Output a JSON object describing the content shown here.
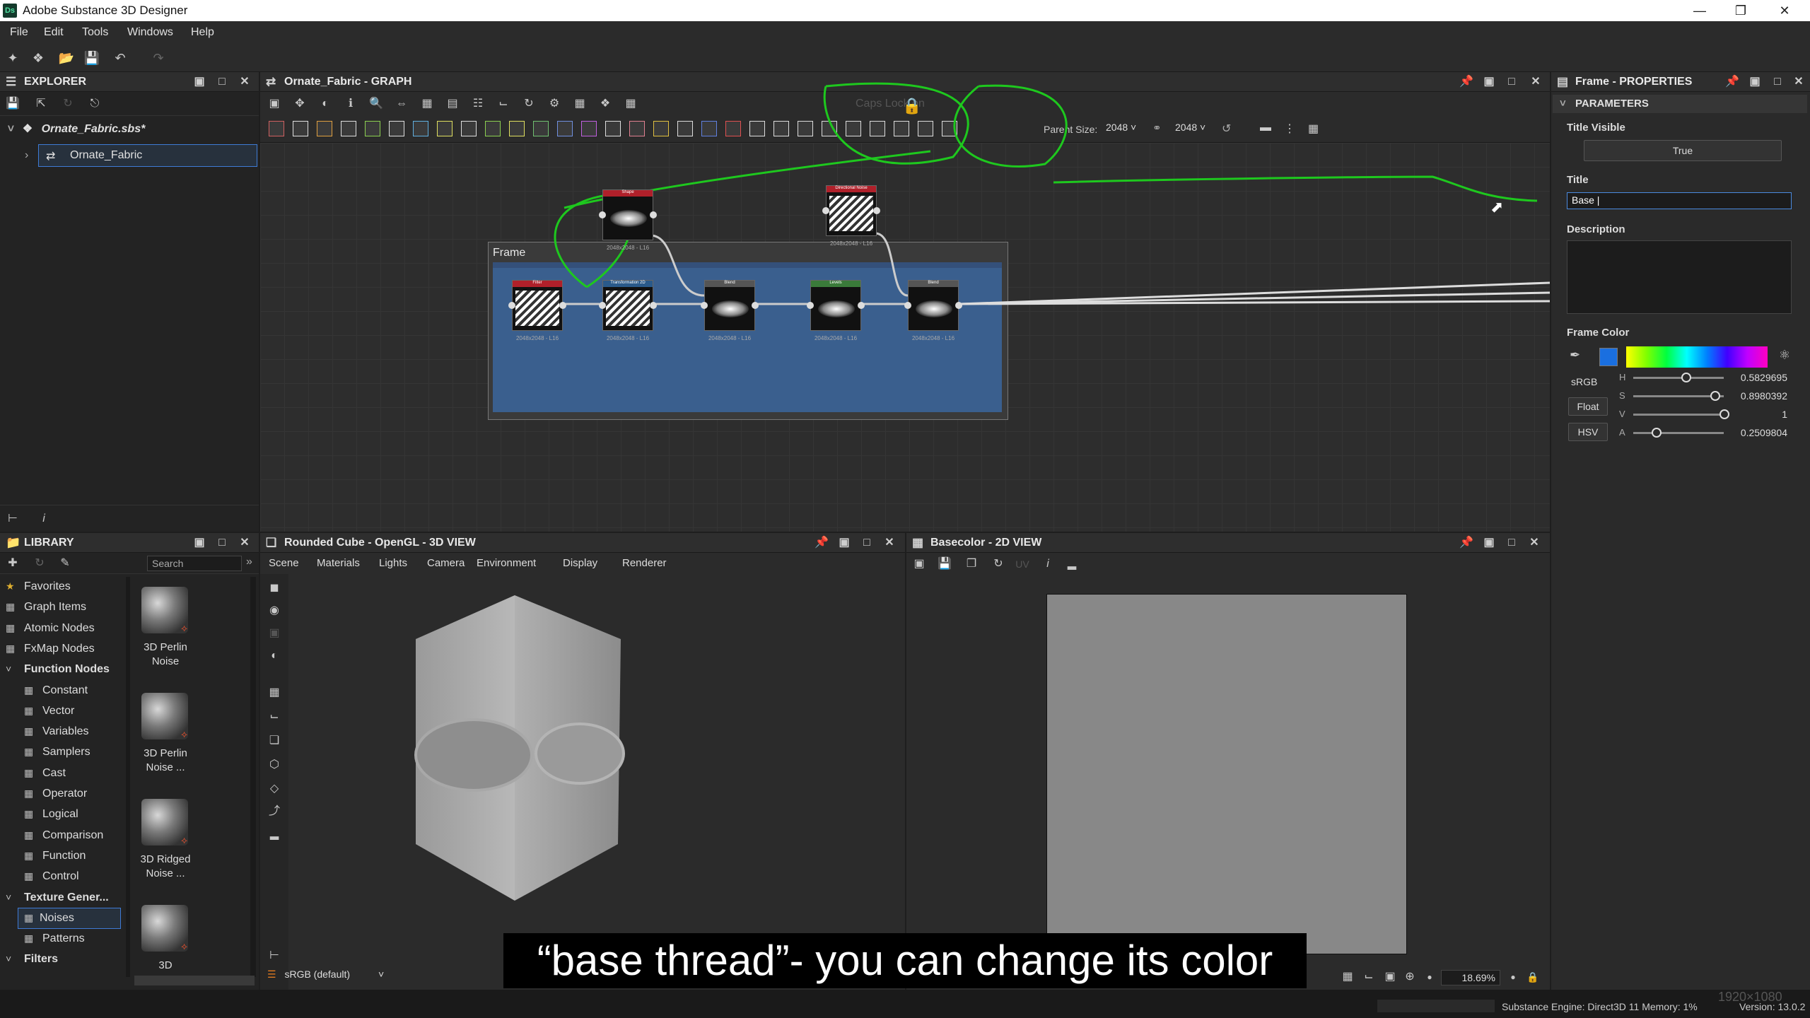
{
  "app": {
    "title": "Adobe Substance 3D Designer",
    "logo": "Ds"
  },
  "menu": [
    "File",
    "Edit",
    "Tools",
    "Windows",
    "Help"
  ],
  "explorer": {
    "title": "EXPLORER",
    "package": "Ornate_Fabric.sbs*",
    "graph_item": "Ornate_Fabric"
  },
  "graph": {
    "title": "Ornate_Fabric - GRAPH",
    "parent_size_label": "Parent Size:",
    "parent_size": "2048",
    "size2": "2048",
    "caps_lock": "Caps Lock on",
    "frame_title": "Frame",
    "nodes": [
      {
        "label": "Shape",
        "res": "2048x2048 - L16",
        "color": "#b0202a"
      },
      {
        "label": "Directional Noise",
        "res": "2048x2048 - L16",
        "color": "#b0202a"
      },
      {
        "label": "Filter",
        "res": "2048x2048 - L16",
        "color": "#b0202a"
      },
      {
        "label": "Transformation 2D",
        "res": "2048x2048 - L16",
        "color": "#2a5a8a"
      },
      {
        "label": "Blend",
        "res": "2048x2048 - L16",
        "color": "#555555"
      },
      {
        "label": "Levels",
        "res": "2048x2048 - L16",
        "color": "#3a7a3a"
      },
      {
        "label": "Blend",
        "res": "2048x2048 - L16",
        "color": "#555555"
      }
    ]
  },
  "properties": {
    "title": "Frame - PROPERTIES",
    "section": "PARAMETERS",
    "title_visible_label": "Title Visible",
    "title_visible_value": "True",
    "title_label": "Title",
    "title_value": "Base |",
    "description_label": "Description",
    "frame_color_label": "Frame Color",
    "color_space": "sRGB",
    "float_btn": "Float",
    "hsv_btn": "HSV",
    "channels": [
      {
        "name": "H",
        "value": "0.5829695",
        "level": 0.58
      },
      {
        "name": "S",
        "value": "0.8980392",
        "level": 0.9
      },
      {
        "name": "V",
        "value": "1",
        "level": 1.0
      },
      {
        "name": "A",
        "value": "0.2509804",
        "level": 0.25
      }
    ],
    "swatch_color": "#1a6fe0"
  },
  "library": {
    "title": "LIBRARY",
    "search_placeholder": "Search",
    "items": [
      {
        "label": "Favorites",
        "icon": "star-icon",
        "indent": 0
      },
      {
        "label": "Graph Items",
        "icon": "graph-items-icon",
        "indent": 0
      },
      {
        "label": "Atomic Nodes",
        "icon": "atomic-icon",
        "indent": 0
      },
      {
        "label": "FxMap Nodes",
        "icon": "fxmap-icon",
        "indent": 0
      },
      {
        "label": "Function Nodes",
        "icon": "chevron-down-icon",
        "indent": 0,
        "cat": true
      },
      {
        "label": "Constant",
        "icon": "function-icon",
        "indent": 1
      },
      {
        "label": "Vector",
        "icon": "function-icon",
        "indent": 1
      },
      {
        "label": "Variables",
        "icon": "function-icon",
        "indent": 1
      },
      {
        "label": "Samplers",
        "icon": "function-icon",
        "indent": 1
      },
      {
        "label": "Cast",
        "icon": "function-icon",
        "indent": 1
      },
      {
        "label": "Operator",
        "icon": "function-icon",
        "indent": 1
      },
      {
        "label": "Logical",
        "icon": "function-icon",
        "indent": 1
      },
      {
        "label": "Comparison",
        "icon": "function-icon",
        "indent": 1
      },
      {
        "label": "Function",
        "icon": "function-icon",
        "indent": 1
      },
      {
        "label": "Control",
        "icon": "function-icon",
        "indent": 1
      },
      {
        "label": "Texture Gener...",
        "icon": "chevron-down-icon",
        "indent": 0,
        "cat": true
      },
      {
        "label": "Noises",
        "icon": "noise-icon",
        "indent": 1,
        "selected": true
      },
      {
        "label": "Patterns",
        "icon": "pattern-icon",
        "indent": 1
      },
      {
        "label": "Filters",
        "icon": "chevron-down-icon",
        "indent": 0,
        "cat": true
      }
    ],
    "thumbs": [
      {
        "line1": "3D Perlin",
        "line2": "Noise"
      },
      {
        "line1": "3D Perlin",
        "line2": "Noise ..."
      },
      {
        "line1": "3D Ridged",
        "line2": "Noise ..."
      },
      {
        "line1": "3D",
        "line2": ""
      }
    ]
  },
  "view3d": {
    "title": "Rounded Cube - OpenGL - 3D VIEW",
    "menu": [
      "Scene",
      "Materials",
      "Lights",
      "Camera",
      "Environment",
      "Display",
      "Renderer"
    ],
    "colorspace": "sRGB (default)"
  },
  "view2d": {
    "title": "Basecolor - 2D VIEW",
    "zoom": "18.69%",
    "resolution": "1920×1080"
  },
  "status": {
    "engine": "Substance Engine: Direct3D 11  Memory: 1%",
    "version": "Version: 13.0.2"
  },
  "caption": "“base thread”- you can change its color"
}
